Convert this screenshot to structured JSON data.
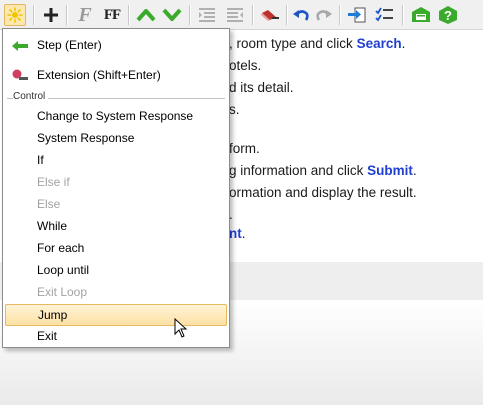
{
  "toolbar": {
    "buttons": [
      {
        "name": "new-step-icon"
      },
      {
        "name": "add-icon"
      },
      {
        "name": "italic-f-icon"
      },
      {
        "name": "font-format-icon",
        "label": "FF"
      },
      {
        "name": "move-up-icon"
      },
      {
        "name": "move-down-icon"
      },
      {
        "name": "outdent-icon"
      },
      {
        "name": "indent-icon"
      },
      {
        "name": "eraser-icon"
      },
      {
        "name": "undo-icon"
      },
      {
        "name": "redo-icon"
      },
      {
        "name": "import-icon"
      },
      {
        "name": "checklist-icon"
      },
      {
        "name": "screen-icon"
      },
      {
        "name": "help-icon"
      }
    ],
    "font_label": "F",
    "format_label": "FF"
  },
  "document": {
    "lines": [
      {
        "pre": ", room type and click ",
        "kw": "Search",
        "post": "."
      },
      {
        "pre": "otels.",
        "kw": "",
        "post": ""
      },
      {
        "pre": "d its detail.",
        "kw": "",
        "post": ""
      },
      {
        "pre": "s.",
        "kw": "",
        "post": ""
      },
      {
        "pre": "",
        "kw": "",
        "post": ""
      },
      {
        "pre": "form.",
        "kw": "",
        "post": ""
      },
      {
        "pre": "g information and click ",
        "kw": "Submit",
        "post": "."
      },
      {
        "pre": "ormation and display the result.",
        "kw": "",
        "post": ""
      },
      {
        "pre": ".",
        "kw": "",
        "post": ""
      },
      {
        "pre": "",
        "kw": "nt",
        "post": "."
      }
    ]
  },
  "menu": {
    "items_top": [
      {
        "label": "Step (Enter)",
        "icon": "step-arrow-icon"
      },
      {
        "label": "Extension (Shift+Enter)",
        "icon": "extension-icon"
      }
    ],
    "group_label": "Control",
    "items": [
      {
        "label": "Change to System Response",
        "disabled": false
      },
      {
        "label": "System Response",
        "disabled": false
      },
      {
        "label": "If",
        "disabled": false
      },
      {
        "label": "Else if",
        "disabled": true
      },
      {
        "label": "Else",
        "disabled": true
      },
      {
        "label": "While",
        "disabled": false
      },
      {
        "label": "For each",
        "disabled": false
      },
      {
        "label": "Loop until",
        "disabled": false
      },
      {
        "label": "Exit Loop",
        "disabled": true
      },
      {
        "label": "Jump",
        "disabled": false,
        "hover": true
      },
      {
        "label": "Exit",
        "disabled": false
      }
    ]
  },
  "colors": {
    "keyword": "#1f3fd1",
    "hover_bg": "#fde1a4",
    "disabled_text": "#a3a3a3"
  }
}
